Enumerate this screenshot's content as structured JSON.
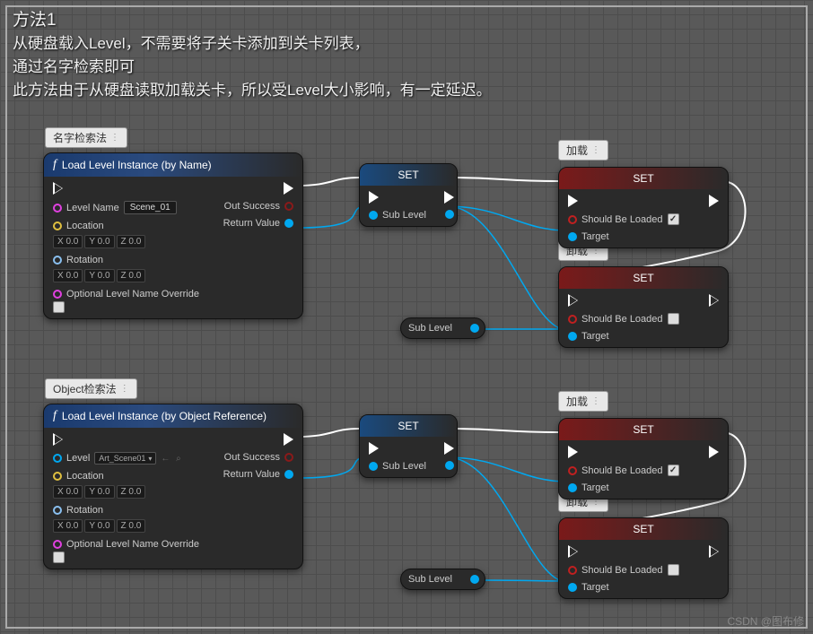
{
  "title": {
    "l1": "方法1",
    "l2": "从硬盘载入Level，不需要将子关卡添加到关卡列表，",
    "l3": "通过名字检索即可",
    "l4": "此方法由于从硬盘读取加载关卡，所以受Level大小影响，有一定延迟。"
  },
  "comments": {
    "c1": "名字检索法",
    "c2": "加载",
    "c3": "卸载",
    "c4": "Object检索法",
    "c5": "加载",
    "c6": "卸载"
  },
  "nodes": {
    "loadByName": {
      "title": "Load Level Instance (by Name)",
      "levelName": "Level Name",
      "levelNameVal": "Scene_01",
      "location": "Location",
      "rotation": "Rotation",
      "x": "X",
      "y": "Y",
      "z": "Z",
      "zero": "0.0",
      "optional": "Optional Level Name Override",
      "outSuccess": "Out Success",
      "returnValue": "Return Value"
    },
    "loadByObj": {
      "title": "Load Level Instance (by Object Reference)",
      "level": "Level",
      "levelVal": "Art_Scene01",
      "location": "Location",
      "rotation": "Rotation",
      "optional": "Optional Level Name Override",
      "outSuccess": "Out Success",
      "returnValue": "Return Value"
    },
    "set": "SET",
    "subLevel": "Sub Level",
    "shouldBeLoaded": "Should Be Loaded",
    "target": "Target"
  },
  "watermark": "CSDN @图布修"
}
